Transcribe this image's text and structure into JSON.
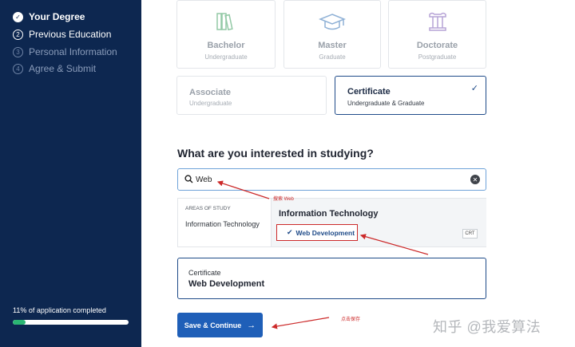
{
  "sidebar": {
    "steps": [
      {
        "number": "✓",
        "label": "Your Degree"
      },
      {
        "number": "2",
        "label": "Previous Education"
      },
      {
        "number": "3",
        "label": "Personal Information"
      },
      {
        "number": "4",
        "label": "Agree & Submit"
      }
    ],
    "progress_text": "11% of application completed",
    "progress_percent": 11
  },
  "degrees": [
    {
      "title": "Bachelor",
      "subtitle": "Undergraduate",
      "icon": "books-icon"
    },
    {
      "title": "Master",
      "subtitle": "Graduate",
      "icon": "graduation-cap-icon"
    },
    {
      "title": "Doctorate",
      "subtitle": "Postgraduate",
      "icon": "column-icon"
    },
    {
      "title": "Associate",
      "subtitle": "Undergraduate"
    },
    {
      "title": "Certificate",
      "subtitle": "Undergraduate & Graduate",
      "selected": true
    }
  ],
  "interest": {
    "heading": "What are you interested in studying?",
    "search_value": "Web",
    "areas_header": "AREAS OF STUDY",
    "areas": [
      "Information Technology"
    ],
    "results_title": "Information Technology",
    "result_item": "Web Development",
    "result_badge": "CRT"
  },
  "summary": {
    "label": "Certificate",
    "value": "Web Development"
  },
  "save_button": "Save & Continue",
  "annotations": {
    "search": "搜索 Web",
    "save": "点击保存"
  },
  "watermark": "知乎 @我爱算法",
  "colors": {
    "sidebar_bg": "#0d2750",
    "accent": "#1f5fb8",
    "selected_border": "#1f4b89",
    "progress": "#2bb673",
    "annotation": "#cc2a2a"
  }
}
